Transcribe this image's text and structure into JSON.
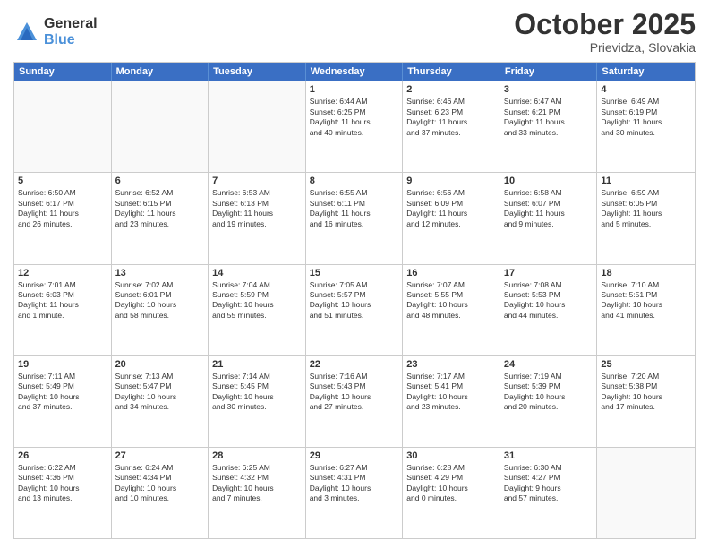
{
  "logo": {
    "general": "General",
    "blue": "Blue"
  },
  "header": {
    "month": "October 2025",
    "location": "Prievidza, Slovakia"
  },
  "days_of_week": [
    "Sunday",
    "Monday",
    "Tuesday",
    "Wednesday",
    "Thursday",
    "Friday",
    "Saturday"
  ],
  "weeks": [
    [
      {
        "day": "",
        "info": ""
      },
      {
        "day": "",
        "info": ""
      },
      {
        "day": "",
        "info": ""
      },
      {
        "day": "1",
        "info": "Sunrise: 6:44 AM\nSunset: 6:25 PM\nDaylight: 11 hours\nand 40 minutes."
      },
      {
        "day": "2",
        "info": "Sunrise: 6:46 AM\nSunset: 6:23 PM\nDaylight: 11 hours\nand 37 minutes."
      },
      {
        "day": "3",
        "info": "Sunrise: 6:47 AM\nSunset: 6:21 PM\nDaylight: 11 hours\nand 33 minutes."
      },
      {
        "day": "4",
        "info": "Sunrise: 6:49 AM\nSunset: 6:19 PM\nDaylight: 11 hours\nand 30 minutes."
      }
    ],
    [
      {
        "day": "5",
        "info": "Sunrise: 6:50 AM\nSunset: 6:17 PM\nDaylight: 11 hours\nand 26 minutes."
      },
      {
        "day": "6",
        "info": "Sunrise: 6:52 AM\nSunset: 6:15 PM\nDaylight: 11 hours\nand 23 minutes."
      },
      {
        "day": "7",
        "info": "Sunrise: 6:53 AM\nSunset: 6:13 PM\nDaylight: 11 hours\nand 19 minutes."
      },
      {
        "day": "8",
        "info": "Sunrise: 6:55 AM\nSunset: 6:11 PM\nDaylight: 11 hours\nand 16 minutes."
      },
      {
        "day": "9",
        "info": "Sunrise: 6:56 AM\nSunset: 6:09 PM\nDaylight: 11 hours\nand 12 minutes."
      },
      {
        "day": "10",
        "info": "Sunrise: 6:58 AM\nSunset: 6:07 PM\nDaylight: 11 hours\nand 9 minutes."
      },
      {
        "day": "11",
        "info": "Sunrise: 6:59 AM\nSunset: 6:05 PM\nDaylight: 11 hours\nand 5 minutes."
      }
    ],
    [
      {
        "day": "12",
        "info": "Sunrise: 7:01 AM\nSunset: 6:03 PM\nDaylight: 11 hours\nand 1 minute."
      },
      {
        "day": "13",
        "info": "Sunrise: 7:02 AM\nSunset: 6:01 PM\nDaylight: 10 hours\nand 58 minutes."
      },
      {
        "day": "14",
        "info": "Sunrise: 7:04 AM\nSunset: 5:59 PM\nDaylight: 10 hours\nand 55 minutes."
      },
      {
        "day": "15",
        "info": "Sunrise: 7:05 AM\nSunset: 5:57 PM\nDaylight: 10 hours\nand 51 minutes."
      },
      {
        "day": "16",
        "info": "Sunrise: 7:07 AM\nSunset: 5:55 PM\nDaylight: 10 hours\nand 48 minutes."
      },
      {
        "day": "17",
        "info": "Sunrise: 7:08 AM\nSunset: 5:53 PM\nDaylight: 10 hours\nand 44 minutes."
      },
      {
        "day": "18",
        "info": "Sunrise: 7:10 AM\nSunset: 5:51 PM\nDaylight: 10 hours\nand 41 minutes."
      }
    ],
    [
      {
        "day": "19",
        "info": "Sunrise: 7:11 AM\nSunset: 5:49 PM\nDaylight: 10 hours\nand 37 minutes."
      },
      {
        "day": "20",
        "info": "Sunrise: 7:13 AM\nSunset: 5:47 PM\nDaylight: 10 hours\nand 34 minutes."
      },
      {
        "day": "21",
        "info": "Sunrise: 7:14 AM\nSunset: 5:45 PM\nDaylight: 10 hours\nand 30 minutes."
      },
      {
        "day": "22",
        "info": "Sunrise: 7:16 AM\nSunset: 5:43 PM\nDaylight: 10 hours\nand 27 minutes."
      },
      {
        "day": "23",
        "info": "Sunrise: 7:17 AM\nSunset: 5:41 PM\nDaylight: 10 hours\nand 23 minutes."
      },
      {
        "day": "24",
        "info": "Sunrise: 7:19 AM\nSunset: 5:39 PM\nDaylight: 10 hours\nand 20 minutes."
      },
      {
        "day": "25",
        "info": "Sunrise: 7:20 AM\nSunset: 5:38 PM\nDaylight: 10 hours\nand 17 minutes."
      }
    ],
    [
      {
        "day": "26",
        "info": "Sunrise: 6:22 AM\nSunset: 4:36 PM\nDaylight: 10 hours\nand 13 minutes."
      },
      {
        "day": "27",
        "info": "Sunrise: 6:24 AM\nSunset: 4:34 PM\nDaylight: 10 hours\nand 10 minutes."
      },
      {
        "day": "28",
        "info": "Sunrise: 6:25 AM\nSunset: 4:32 PM\nDaylight: 10 hours\nand 7 minutes."
      },
      {
        "day": "29",
        "info": "Sunrise: 6:27 AM\nSunset: 4:31 PM\nDaylight: 10 hours\nand 3 minutes."
      },
      {
        "day": "30",
        "info": "Sunrise: 6:28 AM\nSunset: 4:29 PM\nDaylight: 10 hours\nand 0 minutes."
      },
      {
        "day": "31",
        "info": "Sunrise: 6:30 AM\nSunset: 4:27 PM\nDaylight: 9 hours\nand 57 minutes."
      },
      {
        "day": "",
        "info": ""
      }
    ]
  ]
}
